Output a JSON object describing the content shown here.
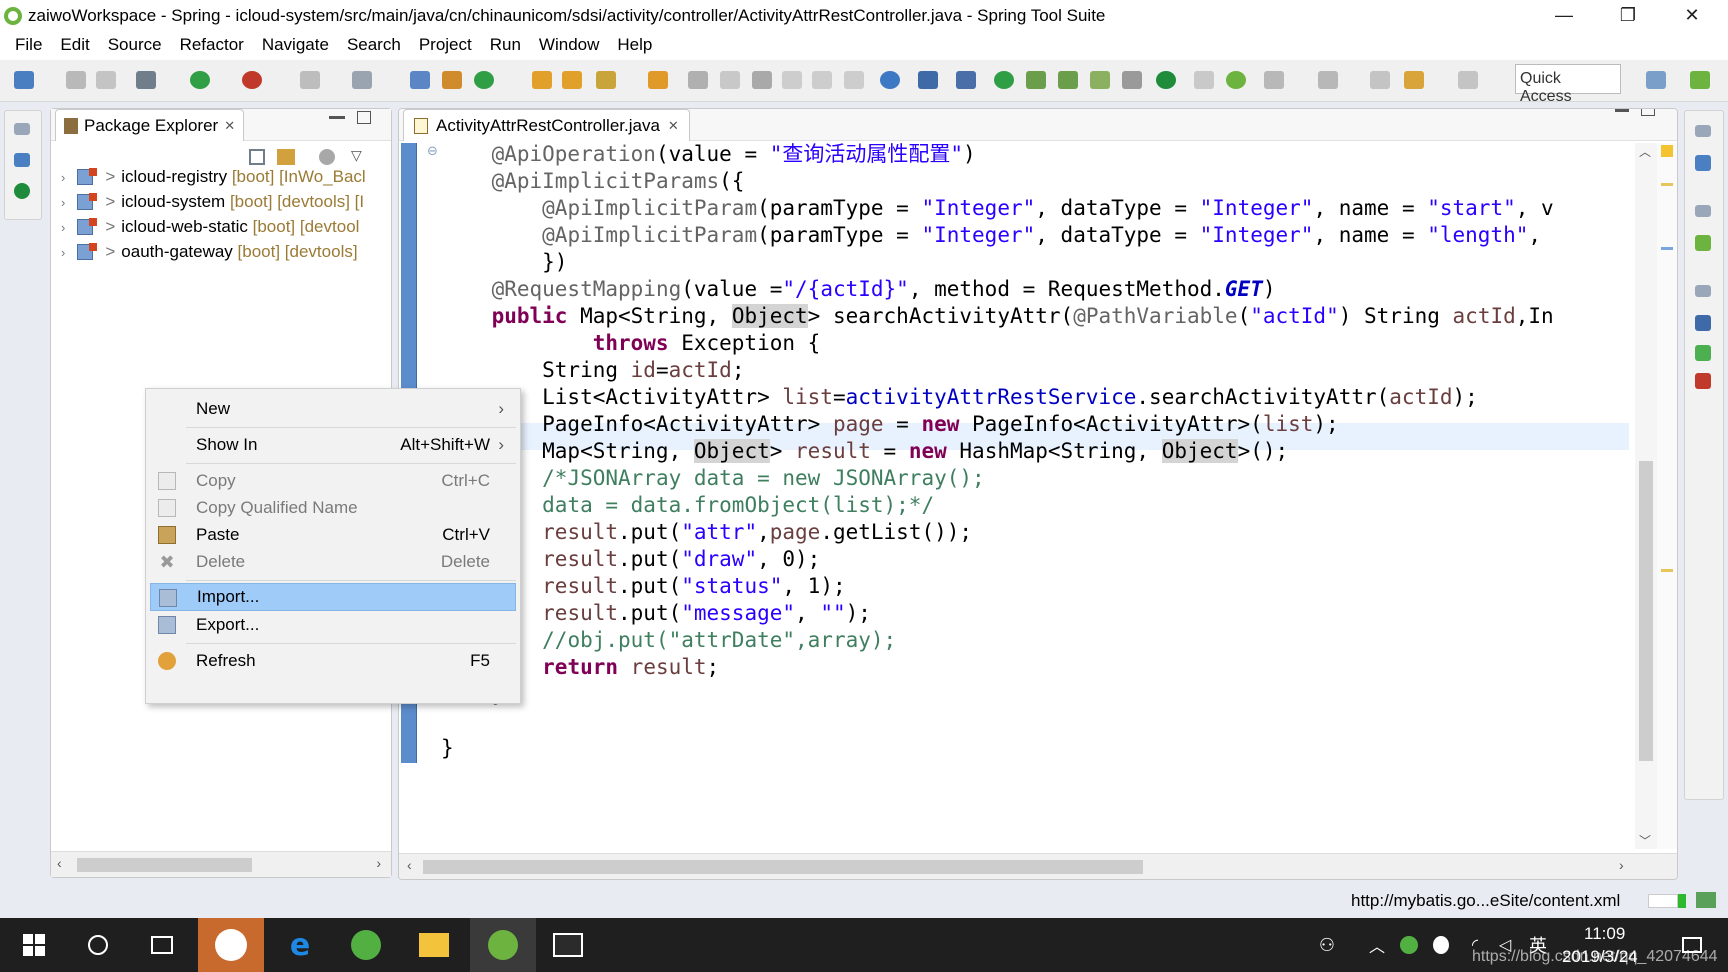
{
  "window": {
    "title": "zaiwoWorkspace - Spring - icloud-system/src/main/java/cn/chinaunicom/sdsi/activity/controller/ActivityAttrRestController.java - Spring Tool Suite",
    "minimize": "—",
    "restore": "❐",
    "close": "✕"
  },
  "menubar": [
    "File",
    "Edit",
    "Source",
    "Refactor",
    "Navigate",
    "Search",
    "Project",
    "Run",
    "Window",
    "Help"
  ],
  "toolbar": {
    "quick_access": "Quick Access"
  },
  "package_explorer": {
    "title": "Package Explorer",
    "close": "✕",
    "projects": [
      {
        "name": "icloud-registry",
        "decoration": "[boot] [InWo_Bacl"
      },
      {
        "name": "icloud-system",
        "decoration": "[boot] [devtools] [I"
      },
      {
        "name": "icloud-web-static",
        "decoration": "[boot] [devtool"
      },
      {
        "name": "oauth-gateway",
        "decoration": "[boot] [devtools]"
      }
    ]
  },
  "editor": {
    "tab": "ActivityAttrRestController.java",
    "close": "✕",
    "collapse_marker": "⊖"
  },
  "context_menu": {
    "new": "New",
    "show_in": "Show In",
    "show_in_shortcut": "Alt+Shift+W",
    "copy": "Copy",
    "copy_shortcut": "Ctrl+C",
    "copy_qualified": "Copy Qualified Name",
    "paste": "Paste",
    "paste_shortcut": "Ctrl+V",
    "delete": "Delete",
    "delete_shortcut": "Delete",
    "import": "Import...",
    "export": "Export...",
    "refresh": "Refresh",
    "refresh_shortcut": "F5",
    "submenu_arrow": "›"
  },
  "status": {
    "text": "http://mybatis.go...eSite/content.xml"
  },
  "taskbar": {
    "time": "11:09",
    "date": "2019/3/24",
    "ime": "英",
    "watermark": "https://blog.csdn.net/qq_42074644"
  },
  "colors": {
    "keyword": "#7f0055",
    "string": "#2a00ff",
    "comment": "#3f7f5f",
    "annotation": "#646464",
    "selection": "#9ecbf7",
    "ruler": "#5b8ccc"
  },
  "icons": [
    "spring-app-icon",
    "search-icon",
    "start-icon",
    "task-view-icon",
    "java-app-icon",
    "edge-icon",
    "browser-icon",
    "explorer-icon",
    "spring-ide-icon",
    "photos-icon"
  ]
}
